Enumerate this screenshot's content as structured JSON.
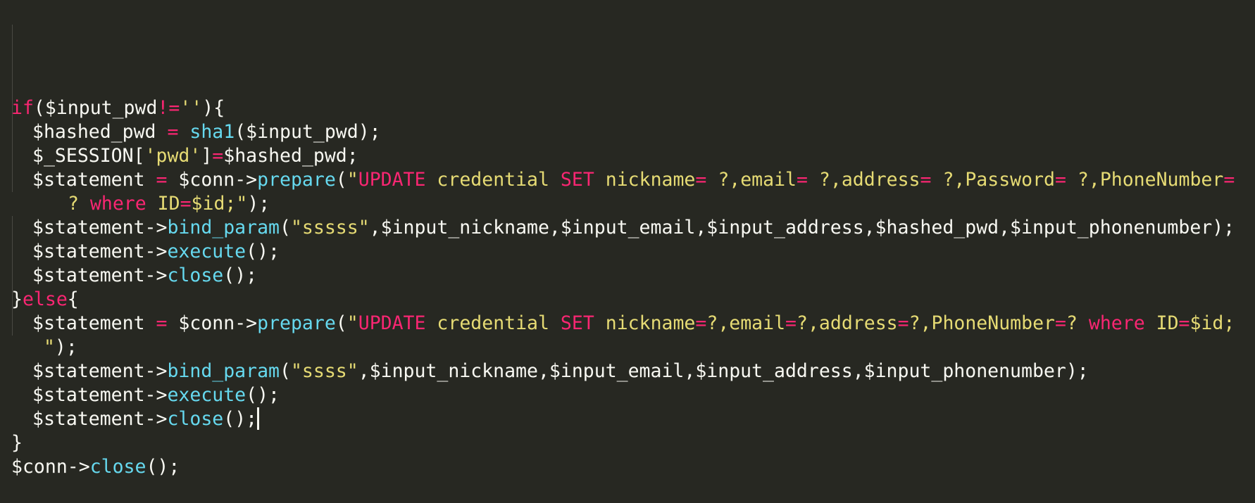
{
  "editor": {
    "colors": {
      "background": "#272822",
      "plain": "#f8f8f2",
      "keyword": "#f92672",
      "function": "#66d9ef",
      "string": "#e6db74"
    },
    "lines": [
      {
        "indent": 0,
        "tokens": [
          [
            "k",
            "if"
          ],
          [
            "p",
            "($input_pwd"
          ],
          [
            "k",
            "!="
          ],
          [
            "s",
            "''"
          ],
          [
            "p",
            "){"
          ]
        ]
      },
      {
        "indent": 1,
        "tokens": [
          [
            "p",
            "$hashed_pwd "
          ],
          [
            "k",
            "="
          ],
          [
            "p",
            " "
          ],
          [
            "f",
            "sha1"
          ],
          [
            "p",
            "($input_pwd);"
          ]
        ]
      },
      {
        "indent": 1,
        "tokens": [
          [
            "p",
            "$_SESSION["
          ],
          [
            "s",
            "'pwd'"
          ],
          [
            "p",
            "]"
          ],
          [
            "k",
            "="
          ],
          [
            "p",
            "$hashed_pwd;"
          ]
        ]
      },
      {
        "indent": 1,
        "tokens": [
          [
            "p",
            "$statement "
          ],
          [
            "k",
            "="
          ],
          [
            "p",
            " $conn->"
          ],
          [
            "f",
            "prepare"
          ],
          [
            "p",
            "("
          ],
          [
            "s",
            "\""
          ],
          [
            "k",
            "UPDATE"
          ],
          [
            "s",
            " credential "
          ],
          [
            "k",
            "SET"
          ],
          [
            "s",
            " nickname"
          ],
          [
            "k",
            "="
          ],
          [
            "s",
            " ?,email"
          ],
          [
            "k",
            "="
          ],
          [
            "s",
            " ?,address"
          ],
          [
            "k",
            "="
          ],
          [
            "s",
            " ?,Password"
          ],
          [
            "k",
            "="
          ],
          [
            "s",
            " ?,PhoneNumber"
          ],
          [
            "k",
            "="
          ]
        ]
      },
      {
        "indent": 2,
        "tokens": [
          [
            "s",
            "? "
          ],
          [
            "k",
            "where"
          ],
          [
            "s",
            " ID"
          ],
          [
            "k",
            "="
          ],
          [
            "s",
            "$id;\""
          ],
          [
            "p",
            ");"
          ]
        ]
      },
      {
        "indent": 1,
        "tokens": [
          [
            "p",
            "$statement->"
          ],
          [
            "f",
            "bind_param"
          ],
          [
            "p",
            "("
          ],
          [
            "s",
            "\"sssss\""
          ],
          [
            "p",
            ",$input_nickname,$input_email,$input_address,$hashed_pwd,$input_phonenumber);"
          ]
        ]
      },
      {
        "indent": 1,
        "tokens": [
          [
            "p",
            "$statement->"
          ],
          [
            "f",
            "execute"
          ],
          [
            "p",
            "();"
          ]
        ]
      },
      {
        "indent": 1,
        "tokens": [
          [
            "p",
            "$statement->"
          ],
          [
            "f",
            "close"
          ],
          [
            "p",
            "();"
          ]
        ]
      },
      {
        "indent": 0,
        "tokens": [
          [
            "p",
            "}"
          ],
          [
            "k",
            "else"
          ],
          [
            "p",
            "{"
          ]
        ]
      },
      {
        "indent": 1,
        "tokens": [
          [
            "p",
            "$statement "
          ],
          [
            "k",
            "="
          ],
          [
            "p",
            " $conn->"
          ],
          [
            "f",
            "prepare"
          ],
          [
            "p",
            "("
          ],
          [
            "s",
            "\""
          ],
          [
            "k",
            "UPDATE"
          ],
          [
            "s",
            " credential "
          ],
          [
            "k",
            "SET"
          ],
          [
            "s",
            " nickname"
          ],
          [
            "k",
            "="
          ],
          [
            "s",
            "?,email"
          ],
          [
            "k",
            "="
          ],
          [
            "s",
            "?,address"
          ],
          [
            "k",
            "="
          ],
          [
            "s",
            "?,PhoneNumber"
          ],
          [
            "k",
            "="
          ],
          [
            "s",
            "? "
          ],
          [
            "k",
            "where"
          ],
          [
            "s",
            " ID"
          ],
          [
            "k",
            "="
          ],
          [
            "s",
            "$id;"
          ]
        ]
      },
      {
        "indent": 1,
        "tokens": [
          [
            "s",
            " \""
          ],
          [
            "p",
            ");"
          ]
        ]
      },
      {
        "indent": 1,
        "tokens": [
          [
            "p",
            "$statement->"
          ],
          [
            "f",
            "bind_param"
          ],
          [
            "p",
            "("
          ],
          [
            "s",
            "\"ssss\""
          ],
          [
            "p",
            ",$input_nickname,$input_email,$input_address,$input_phonenumber);"
          ]
        ]
      },
      {
        "indent": 1,
        "tokens": [
          [
            "p",
            "$statement->"
          ],
          [
            "f",
            "execute"
          ],
          [
            "p",
            "();"
          ]
        ]
      },
      {
        "indent": 1,
        "tokens": [
          [
            "p",
            "$statement->"
          ],
          [
            "f",
            "close"
          ],
          [
            "p",
            "();"
          ]
        ],
        "cursor": true
      },
      {
        "indent": 0,
        "tokens": [
          [
            "p",
            "}"
          ]
        ]
      },
      {
        "indent": 0,
        "tokens": [
          [
            "p",
            "$conn->"
          ],
          [
            "f",
            "close"
          ],
          [
            "p",
            "();"
          ]
        ]
      }
    ]
  }
}
